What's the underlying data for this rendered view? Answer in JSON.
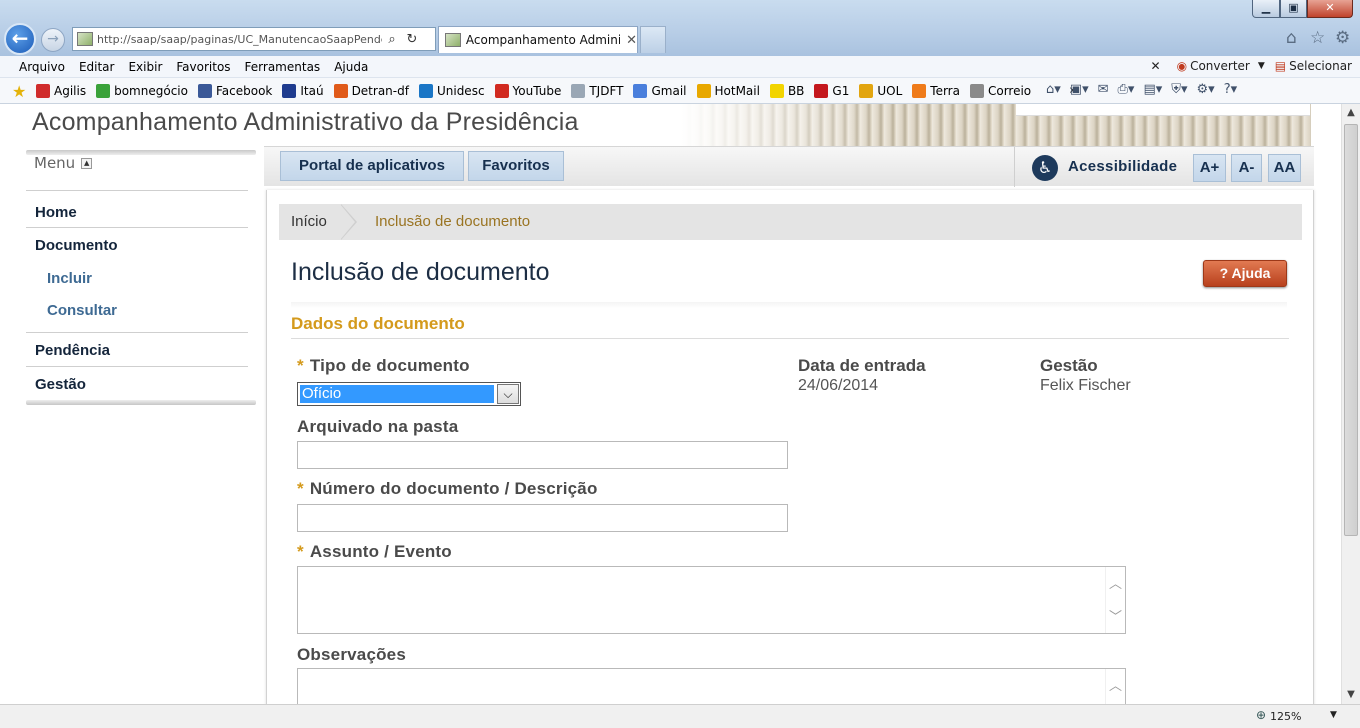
{
  "browser": {
    "address_url": "http://saap/saap/paginas/UC_ManutencaoSaapPende",
    "tab_title": "Acompanhamento Admini...",
    "menu": [
      "Arquivo",
      "Editar",
      "Exibir",
      "Favoritos",
      "Ferramentas",
      "Ajuda"
    ],
    "menu_right": {
      "converter": "Converter",
      "selecionar": "Selecionar"
    },
    "favorites": [
      {
        "label": "Agilis",
        "color": "#d02c2c"
      },
      {
        "label": "bomnegócio",
        "color": "#3aa23a"
      },
      {
        "label": "Facebook",
        "color": "#3b5998"
      },
      {
        "label": "Itaú",
        "color": "#1f3c8f"
      },
      {
        "label": "Detran-df",
        "color": "#e05a1a"
      },
      {
        "label": "Unidesc",
        "color": "#1a76c6"
      },
      {
        "label": "YouTube",
        "color": "#d12a20"
      },
      {
        "label": "TJDFT",
        "color": "#9aa7b5"
      },
      {
        "label": "Gmail",
        "color": "#4a7fdc"
      },
      {
        "label": "HotMail",
        "color": "#e8a800"
      },
      {
        "label": "BB",
        "color": "#f2d400"
      },
      {
        "label": "G1",
        "color": "#c4171d"
      },
      {
        "label": "UOL",
        "color": "#e2a510"
      },
      {
        "label": "Terra",
        "color": "#ef7b1a"
      },
      {
        "label": "Correio",
        "color": "#8a8a8a"
      }
    ],
    "zoom": "125%"
  },
  "app": {
    "title": "Acompanhamento Administrativo da Presidência",
    "sidebar": {
      "toggle_label": "Menu",
      "home": "Home",
      "documento": "Documento",
      "incluir": "Incluir",
      "consultar": "Consultar",
      "pendencia": "Pendência",
      "gestao": "Gestão"
    },
    "nav": {
      "portal": "Portal de aplicativos",
      "favoritos": "Favoritos",
      "acessibilidade": "Acessibilidade",
      "a_plus": "A+",
      "a_minus": "A-",
      "aa": "AA"
    },
    "breadcrumb": {
      "home": "Início",
      "current": "Inclusão de documento"
    },
    "page_title": "Inclusão de documento",
    "help_label": "Ajuda",
    "section_title": "Dados do documento",
    "form": {
      "required_mark": "*",
      "tipo_label": "Tipo de documento",
      "tipo_value": "Ofício",
      "data_label": "Data de entrada",
      "data_value": "24/06/2014",
      "gestao_label": "Gestão",
      "gestao_value": "Felix Fischer",
      "pasta_label": "Arquivado na pasta",
      "pasta_value": "",
      "numero_label": "Número do documento / Descrição",
      "numero_value": "",
      "assunto_label": "Assunto / Evento",
      "assunto_value": "",
      "obs_label": "Observações",
      "obs_value": ""
    }
  }
}
